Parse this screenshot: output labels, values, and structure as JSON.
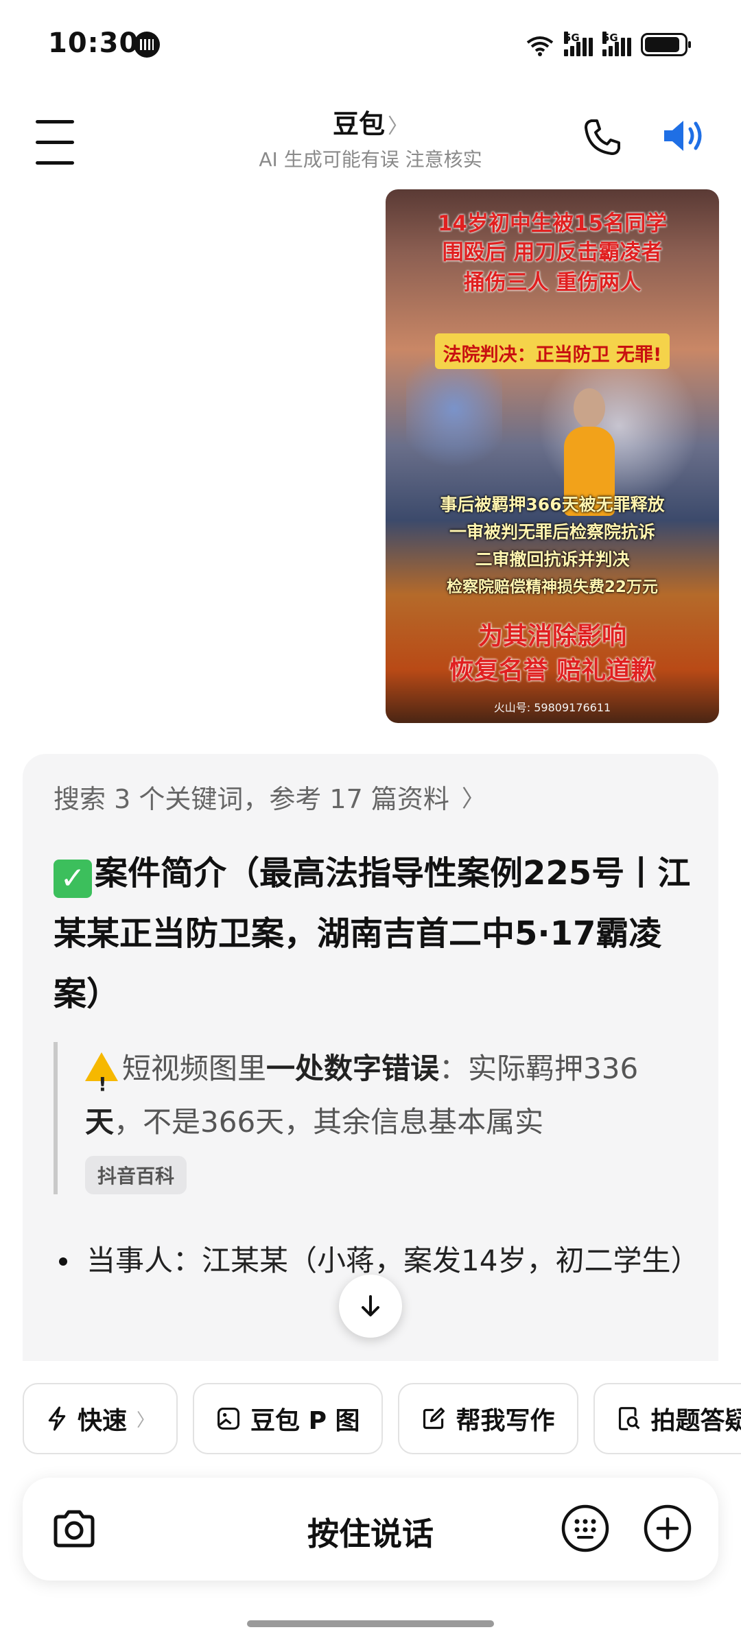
{
  "status_bar": {
    "time": "10:30",
    "signal1_label": "5G",
    "signal2_label": "5G"
  },
  "header": {
    "title": "豆包",
    "subtitle": "AI 生成可能有误 注意核实"
  },
  "image_message": {
    "headline": [
      "14岁初中生被15名同学",
      "围殴后 用刀反击霸凌者",
      "捅伤三人 重伤两人"
    ],
    "verdict": "法院判决：正当防卫 无罪!",
    "details": [
      "事后被羁押366天被无罪释放",
      "一审被判无罪后检察院抗诉",
      "二审撤回抗诉并判决",
      "检察院赔偿精神损失费22万元"
    ],
    "footer_lines": [
      "为其消除影响",
      "恢复名誉 赔礼道歉"
    ],
    "watermark": "火山号: 59809176611"
  },
  "reply": {
    "search_summary": "搜索 3 个关键词，参考 17 篇资料",
    "case_title": "案件简介（最高法指导性案例225号丨江某某正当防卫案，湖南吉首二中5·17霸凌案）",
    "quote_prefix": "短视频图里",
    "quote_bold": "一处数字错误",
    "quote_rest": "：实际羁押336",
    "quote_bold2": "天",
    "quote_tail": "，不是366天，其余信息基本属实",
    "source_tag": "抖音百科",
    "bullet": "当事人：江某某（小蒋，案发14岁，初二学生）"
  },
  "chips": [
    {
      "label": "快速",
      "icon": "lightning-icon"
    },
    {
      "label": "豆包 P 图",
      "icon": "image-edit-icon"
    },
    {
      "label": "帮我写作",
      "icon": "pencil-icon"
    },
    {
      "label": "拍题答疑",
      "icon": "search-doc-icon"
    }
  ],
  "input_bar": {
    "voice_label": "按住说话"
  },
  "colors": {
    "accent_blue": "#1f6fe5",
    "check_green": "#3cbf5c",
    "warning_yellow": "#f6b800"
  }
}
